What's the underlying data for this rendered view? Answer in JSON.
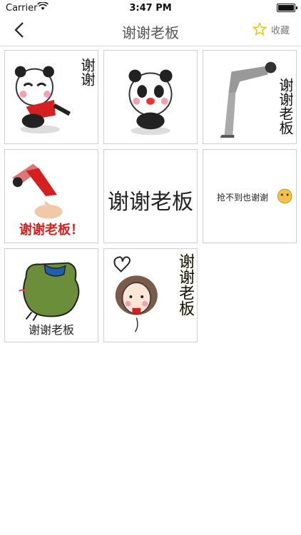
{
  "status": {
    "carrier": "Carrier",
    "time": "3:47 PM"
  },
  "nav": {
    "title": "谢谢老板",
    "favorite_label": "收藏"
  },
  "stickers": [
    {
      "caption": "谢谢",
      "desc": "panda"
    },
    {
      "caption": "",
      "desc": "panda2"
    },
    {
      "caption": "谢谢老板",
      "desc": "bowing"
    },
    {
      "caption": "谢谢老板！",
      "desc": "kneel"
    },
    {
      "caption": "谢谢老板",
      "desc": "text"
    },
    {
      "caption": "抢不到也谢谢",
      "desc": "text-small"
    },
    {
      "caption": "谢谢老板",
      "desc": "frog"
    },
    {
      "caption": "谢谢老板",
      "desc": "girl"
    }
  ]
}
